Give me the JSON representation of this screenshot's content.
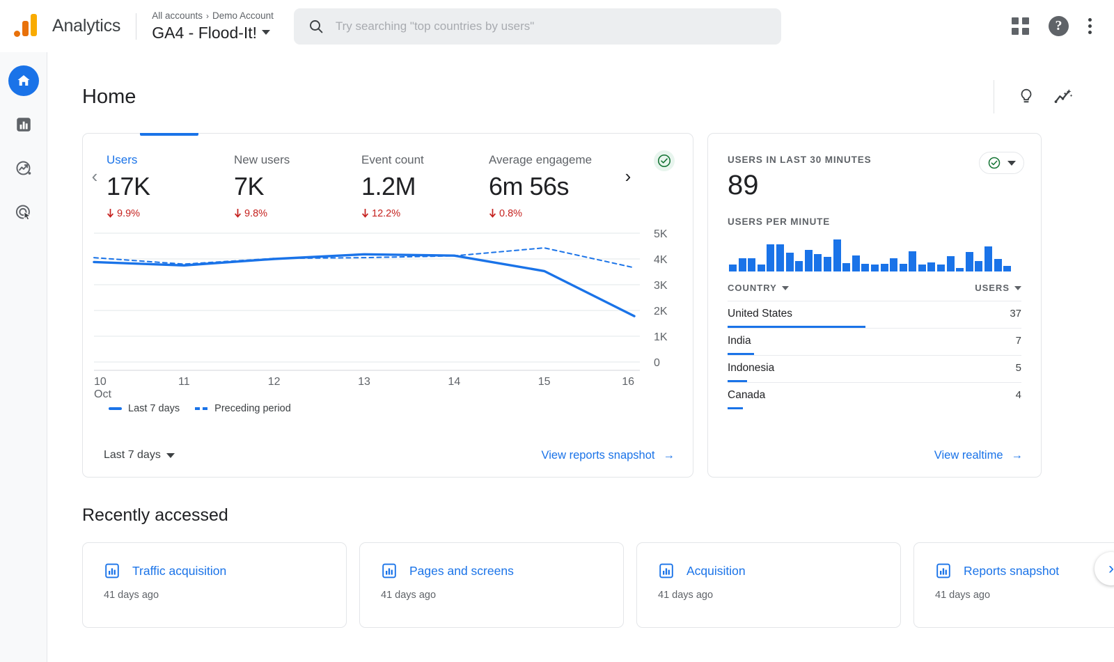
{
  "topbar": {
    "brand": "Analytics",
    "breadcrumb_all": "All accounts",
    "breadcrumb_sep": "›",
    "breadcrumb_account": "Demo Account",
    "property_name": "GA4 - Flood-It!",
    "search_placeholder": "Try searching \"top countries by users\"",
    "help_glyph": "?"
  },
  "rail": {
    "items": [
      {
        "name": "home",
        "label": "Home",
        "active": true
      },
      {
        "name": "reports",
        "label": "Reports",
        "active": false
      },
      {
        "name": "explore",
        "label": "Explore",
        "active": false
      },
      {
        "name": "advertising",
        "label": "Advertising",
        "active": false
      }
    ]
  },
  "page": {
    "title": "Home"
  },
  "overview": {
    "metrics": [
      {
        "label": "Users",
        "value": "17K",
        "delta": "9.9%",
        "direction": "down",
        "selected": true
      },
      {
        "label": "New users",
        "value": "7K",
        "delta": "9.8%",
        "direction": "down",
        "selected": false
      },
      {
        "label": "Event count",
        "value": "1.2M",
        "delta": "12.2%",
        "direction": "down",
        "selected": false
      },
      {
        "label": "Average engageme",
        "value": "6m 56s",
        "delta": "0.8%",
        "direction": "down",
        "selected": false
      }
    ],
    "prev_arrow": "‹",
    "next_arrow": "›",
    "legend": [
      {
        "label": "Last 7 days",
        "style": "solid"
      },
      {
        "label": "Preceding period",
        "style": "dashed"
      }
    ],
    "date_range": "Last 7 days",
    "footer_link": "View reports snapshot",
    "footer_link_arrow": "→",
    "accent_color": "#1a73e8",
    "negative_color": "#c5221f"
  },
  "chart_data": {
    "type": "line",
    "title": "",
    "xlabel": "Oct",
    "ylabel": "",
    "x": [
      "10",
      "11",
      "12",
      "13",
      "14",
      "15",
      "16"
    ],
    "x_axis_note": "Oct",
    "ylim": [
      0,
      5000
    ],
    "yticks": [
      0,
      1000,
      2000,
      3000,
      4000,
      5000
    ],
    "ytick_labels": [
      "0",
      "1K",
      "2K",
      "3K",
      "4K",
      "5K"
    ],
    "grid": true,
    "legend_position": "bottom-left",
    "series": [
      {
        "name": "Last 7 days",
        "style": "solid",
        "color": "#1a73e8",
        "values": [
          3880,
          3750,
          4000,
          4180,
          4130,
          3530,
          1780
        ]
      },
      {
        "name": "Preceding period",
        "style": "dashed",
        "color": "#1a73e8",
        "values": [
          4050,
          3800,
          4020,
          4050,
          4120,
          4430,
          3660
        ]
      }
    ]
  },
  "realtime": {
    "users_label": "USERS IN LAST 30 MINUTES",
    "users_value": "89",
    "per_minute_label": "USERS PER MINUTE",
    "per_minute_values": [
      8,
      16,
      16,
      8,
      32,
      32,
      22,
      12,
      26,
      21,
      17,
      38,
      10,
      19,
      9,
      8,
      9,
      16,
      9,
      24,
      8,
      11,
      8,
      18,
      4,
      23,
      12,
      30,
      15,
      7
    ],
    "per_minute_max": 38,
    "table": {
      "col_country": "COUNTRY",
      "col_users": "USERS",
      "rows": [
        {
          "country": "United States",
          "users": "37",
          "bar_pct": 100
        },
        {
          "country": "India",
          "users": "7",
          "bar_pct": 19
        },
        {
          "country": "Indonesia",
          "users": "5",
          "bar_pct": 14
        },
        {
          "country": "Canada",
          "users": "4",
          "bar_pct": 11
        }
      ]
    },
    "footer_link": "View realtime",
    "footer_link_arrow": "→"
  },
  "recent": {
    "title": "Recently accessed",
    "items": [
      {
        "name": "Traffic acquisition",
        "time": "41 days ago"
      },
      {
        "name": "Pages and screens",
        "time": "41 days ago"
      },
      {
        "name": "Acquisition",
        "time": "41 days ago"
      },
      {
        "name": "Reports snapshot",
        "time": "41 days ago"
      }
    ],
    "next_arrow": "›"
  }
}
